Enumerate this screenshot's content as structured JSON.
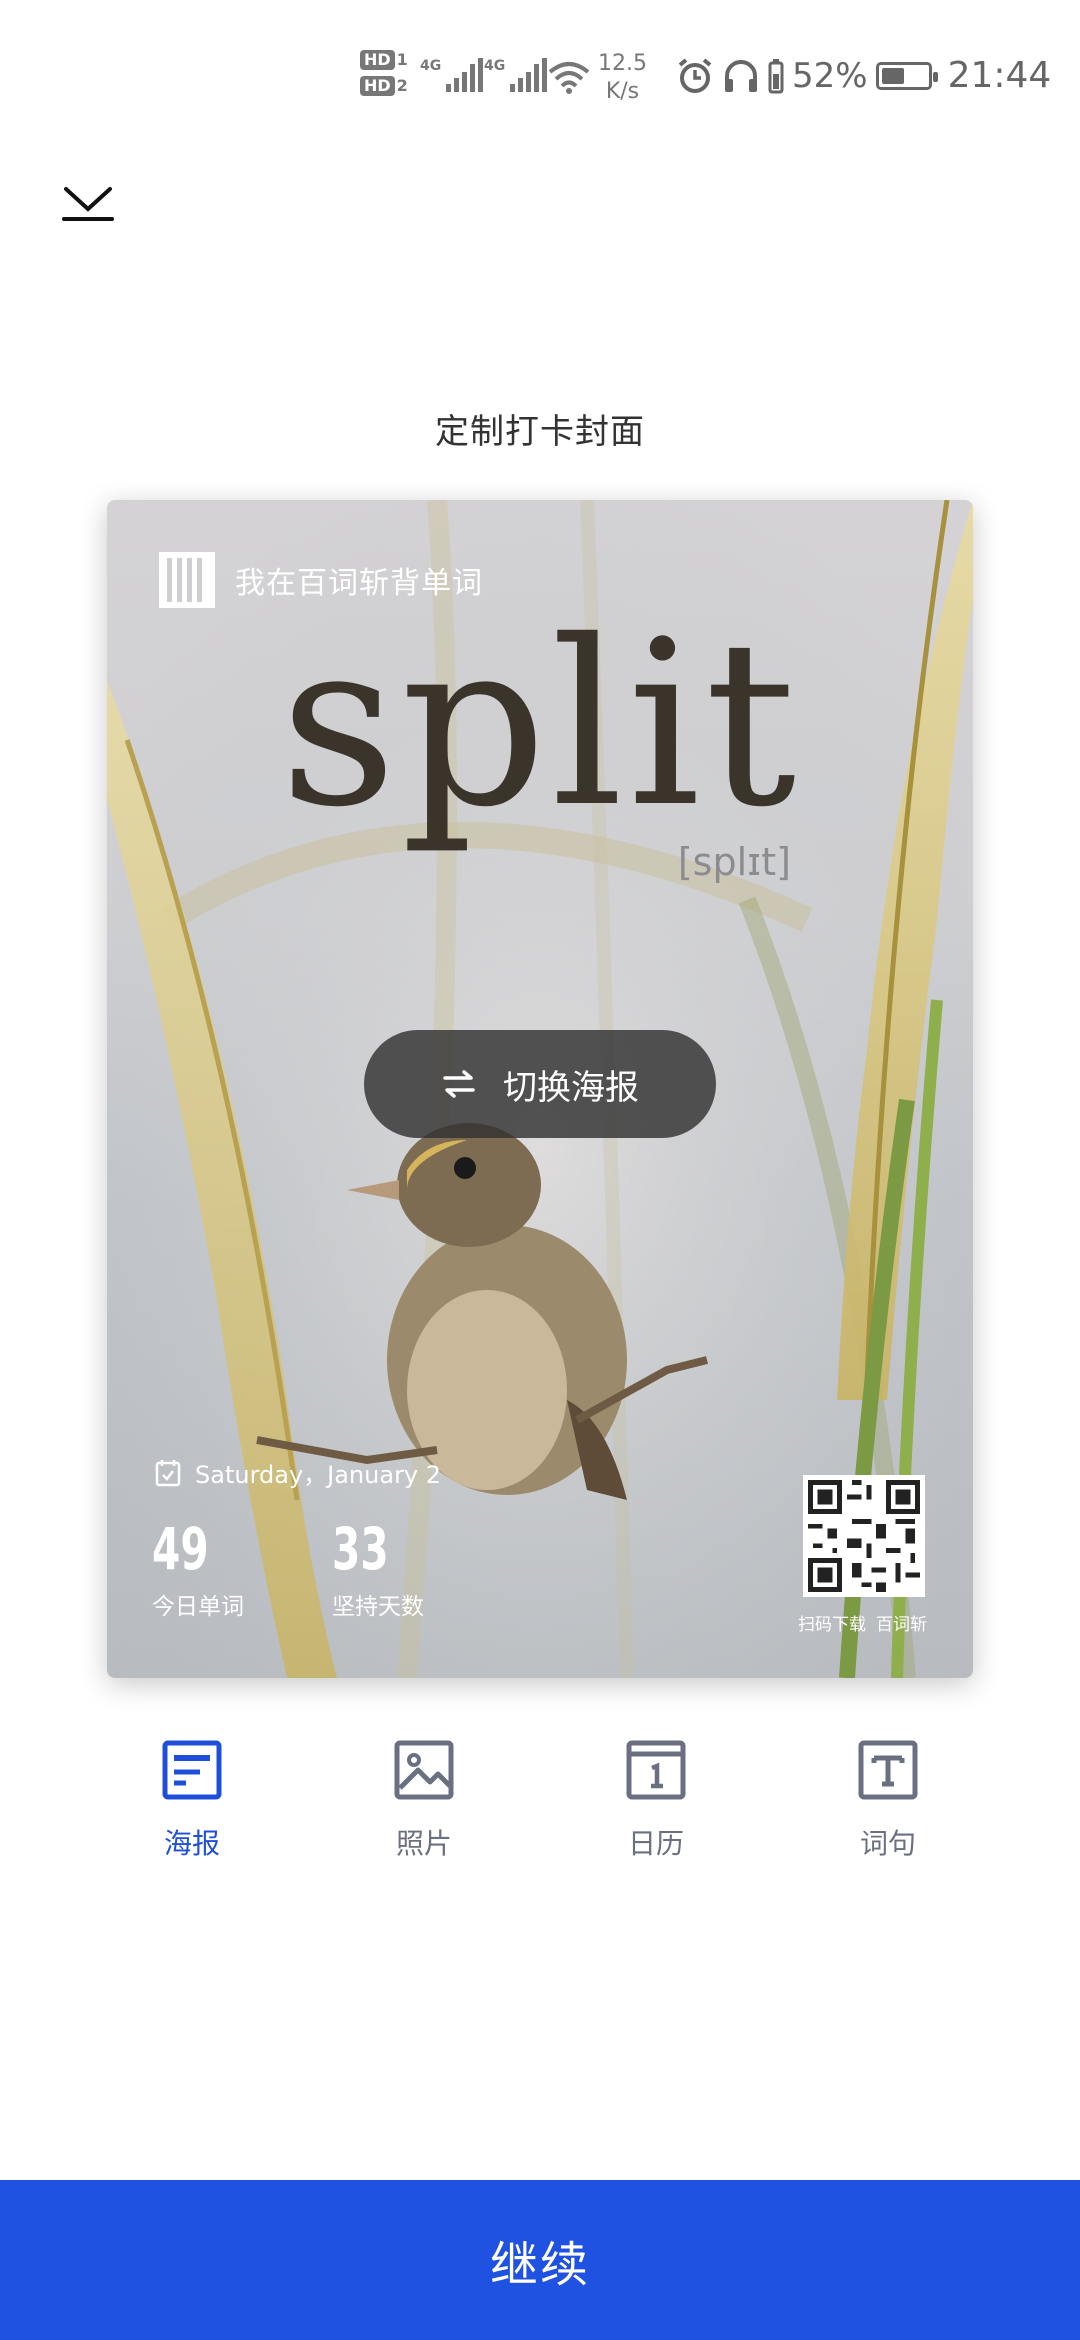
{
  "status_bar": {
    "hd1": "HD",
    "hd1_sim": "1",
    "hd2": "HD",
    "hd2_sim": "2",
    "net1": "4G",
    "net2": "4G",
    "speed_value": "12.5",
    "speed_unit": "K/s",
    "battery_pct": "52%",
    "battery_level": 0.52,
    "time": "21:44"
  },
  "header": {
    "title": "定制打卡封面"
  },
  "poster": {
    "brand_text": "我在百词斩背单词",
    "word": "split",
    "phonetic": "[splɪt]",
    "switch_label": "切换海报",
    "date": "Saturday，January 2",
    "stats": [
      {
        "value": "49",
        "label": "今日单词"
      },
      {
        "value": "33",
        "label": "坚持天数"
      }
    ],
    "qr_caption_left": "扫码下载",
    "qr_caption_right": "百词斩"
  },
  "tabs": [
    {
      "label": "海报",
      "icon": "poster-icon",
      "active": true
    },
    {
      "label": "照片",
      "icon": "photo-icon",
      "active": false
    },
    {
      "label": "日历",
      "icon": "calendar-icon",
      "active": false
    },
    {
      "label": "词句",
      "icon": "text-icon",
      "active": false
    }
  ],
  "continue_label": "继续",
  "colors": {
    "accent": "#1f52e0",
    "tab_active": "#1f4fd8",
    "tab_inactive": "#6a7080"
  }
}
